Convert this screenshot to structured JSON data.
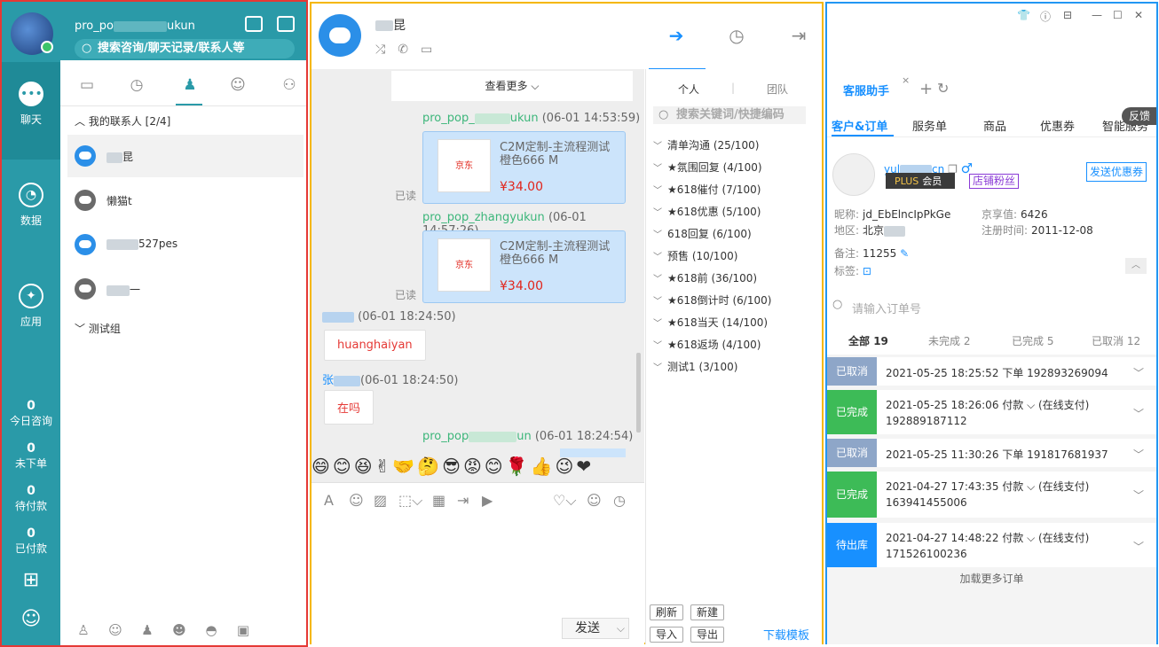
{
  "colors": {
    "teal": "#2a9aa8",
    "blue": "#1890ff",
    "red": "#e53935",
    "green": "#3cb67a"
  },
  "nav": {
    "items": [
      {
        "label": "聊天",
        "icon": "chat-bubble-icon"
      },
      {
        "label": "数据",
        "icon": "pie-chart-icon"
      },
      {
        "label": "应用",
        "icon": "magic-wand-icon"
      }
    ],
    "stats": [
      {
        "value": "0",
        "label": "今日咨询"
      },
      {
        "value": "0",
        "label": "未下单"
      },
      {
        "value": "0",
        "label": "待付款"
      },
      {
        "value": "0",
        "label": "已付款"
      }
    ]
  },
  "account": {
    "name_prefix": "pro_po",
    "name_suffix": "ukun",
    "search_placeholder": "搜索咨询/聊天记录/联系人等"
  },
  "contacts": {
    "group1": "我的联系人 [2/4]",
    "items": [
      {
        "name": "昆"
      },
      {
        "name": "懒猫t"
      },
      {
        "name": "527pes"
      },
      {
        "name": "一"
      }
    ],
    "group2": "测试组"
  },
  "chat": {
    "title": "昆",
    "load_more": "查看更多",
    "messages": [
      {
        "sender_prefix": "pro_pop_",
        "sender_suffix": "ukun",
        "time": "(06-01 14:53:59)",
        "title": "C2M定制-主流程测试 橙色666 M",
        "price": "¥34.00",
        "read": "已读",
        "img_label": "京东"
      },
      {
        "sender": "pro_pop_zhangyukun",
        "time": "(06-01 14:57:26)",
        "title": "C2M定制-主流程测试 橙色666 M",
        "price": "¥34.00",
        "read": "已读",
        "img_label": "京东"
      }
    ],
    "incoming": [
      {
        "time": "(06-01 18:24:50)",
        "text": "huanghaiyan"
      },
      {
        "sender_prefix": "张",
        "time": "(06-01 18:24:50)",
        "text": "在吗"
      }
    ],
    "last": {
      "sender_prefix": "pro_pop",
      "sender_suffix": "un",
      "time": "(06-01 18:24:54)"
    },
    "emojis": "😄😊😆✌🤝🤔😎😡😊🌹👍😉❤",
    "send_label": "发送"
  },
  "quick": {
    "tabs": [
      "个人",
      "团队"
    ],
    "search_placeholder": "搜索关键词/快捷编码",
    "items": [
      "清单沟通 (25/100)",
      "★氛围回复 (4/100)",
      "★618催付 (7/100)",
      "★618优惠 (5/100)",
      "618回复 (6/100)",
      "预售 (10/100)",
      "★618前 (36/100)",
      "★618倒计时 (6/100)",
      "★618当天 (14/100)",
      "★618返场 (4/100)",
      "测试1 (3/100)"
    ],
    "buttons": {
      "refresh": "刷新",
      "create": "新建",
      "import": "导入",
      "export": "导出"
    },
    "download": "下载模板"
  },
  "assistant": {
    "tab": "客服助手",
    "feedback": "反馈",
    "tabs": [
      "客户&订单",
      "服务单",
      "商品",
      "优惠券",
      "智能服务"
    ],
    "customer": {
      "user_prefix": "yul",
      "user_suffix": "cn",
      "plus": "PLUS",
      "member": "会员",
      "fans": "店铺粉丝",
      "coupon_btn": "发送优惠券",
      "nickname_label": "昵称:",
      "nickname": "jd_EbElncIpPkGe",
      "jx_label": "京享值:",
      "jx": "6426",
      "region_label": "地区:",
      "region": "北京",
      "reg_label": "注册时间:",
      "reg": "2011-12-08",
      "note_label": "备注:",
      "note": "11255",
      "tag_label": "标签:"
    },
    "order_search": "请输入订单号",
    "status_tabs": [
      {
        "label": "全部",
        "count": "19"
      },
      {
        "label": "未完成",
        "count": "2"
      },
      {
        "label": "已完成",
        "count": "5"
      },
      {
        "label": "已取消",
        "count": "12"
      }
    ],
    "orders": [
      {
        "status": "已取消",
        "color": "#8ea6c8",
        "line1": "2021-05-25 18:25:52 下单   192893269094",
        "line2": ""
      },
      {
        "status": "已完成",
        "color": "#3dbb57",
        "line1": "2021-05-25 18:26:06 付款 ⌵     (在线支付)",
        "line2": "192889187112"
      },
      {
        "status": "已取消",
        "color": "#8ea6c8",
        "line1": "2021-05-25 11:30:26 下单   191817681937",
        "line2": ""
      },
      {
        "status": "已完成",
        "color": "#3dbb57",
        "line1": "2021-04-27 17:43:35 付款 ⌵     (在线支付)",
        "line2": "163941455006"
      },
      {
        "status": "待出库",
        "color": "#1890ff",
        "line1": "2021-04-27 14:48:22 付款 ⌵     (在线支付)",
        "line2": "171526100236"
      }
    ],
    "load_more": "加载更多订单"
  }
}
